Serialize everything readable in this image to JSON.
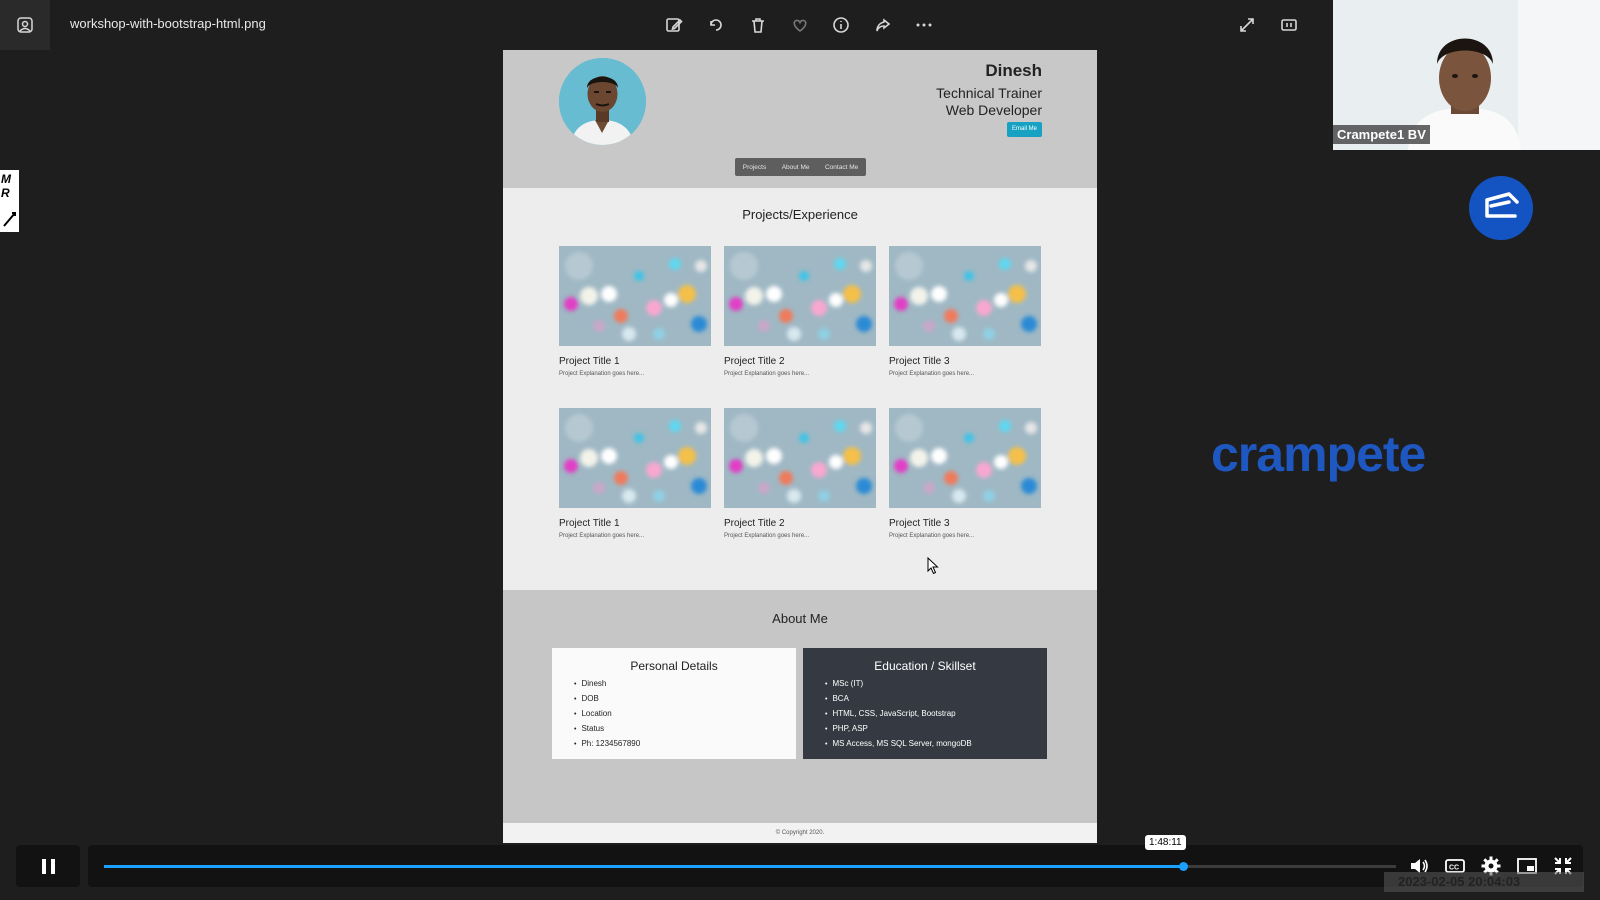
{
  "viewer": {
    "file_name": "workshop-with-bootstrap-html.png",
    "toolbar_icons": [
      "edit-image-icon",
      "rotate-icon",
      "delete-icon",
      "favorite-icon",
      "info-icon",
      "share-icon",
      "more-icon",
      "fullscreen-icon",
      "actual-size-icon"
    ]
  },
  "profile": {
    "name": "Dinesh",
    "role_1": "Technical Trainer",
    "role_2": "Web Developer",
    "email_button": "Email Me",
    "nav": [
      "Projects",
      "About Me",
      "Contact Me"
    ]
  },
  "projects": {
    "heading": "Projects/Experience",
    "items": [
      {
        "title": "Project Title 1",
        "desc": "Project Explanation goes here..."
      },
      {
        "title": "Project Title 2",
        "desc": "Project Explanation goes here..."
      },
      {
        "title": "Project Title 3",
        "desc": "Project Explanation goes here..."
      },
      {
        "title": "Project Title 1",
        "desc": "Project Explanation goes here..."
      },
      {
        "title": "Project Title 2",
        "desc": "Project Explanation goes here..."
      },
      {
        "title": "Project Title 3",
        "desc": "Project Explanation goes here..."
      }
    ]
  },
  "about": {
    "heading": "About Me",
    "personal": {
      "title": "Personal Details",
      "items": [
        "Dinesh",
        "DOB",
        "Location",
        "Status",
        "Ph: 1234567890"
      ]
    },
    "education": {
      "title": "Education / Skillset",
      "items": [
        "MSc (IT)",
        "BCA",
        "HTML, CSS, JavaScript, Bootstrap",
        "PHP, ASP",
        "MS Access, MS SQL Server, mongoDB"
      ]
    }
  },
  "footer": "© Copyright 2020.",
  "meeting": {
    "participant_name": "Crampete1 BV",
    "brand_name": "crampete",
    "overlay_timestamp": "2023-02-05 20:04:03",
    "left_widget_letters": [
      "M",
      "R"
    ]
  },
  "player": {
    "time_tooltip": "1:48:11",
    "progress_fraction": 0.835,
    "control_icons": [
      "volume-icon",
      "captions-icon",
      "settings-icon",
      "miniplayer-icon",
      "exit-fullscreen-icon"
    ]
  },
  "colors": {
    "accent": "#1aa0ff",
    "brand": "#1f57c0",
    "email_button": "#17a2c4"
  }
}
